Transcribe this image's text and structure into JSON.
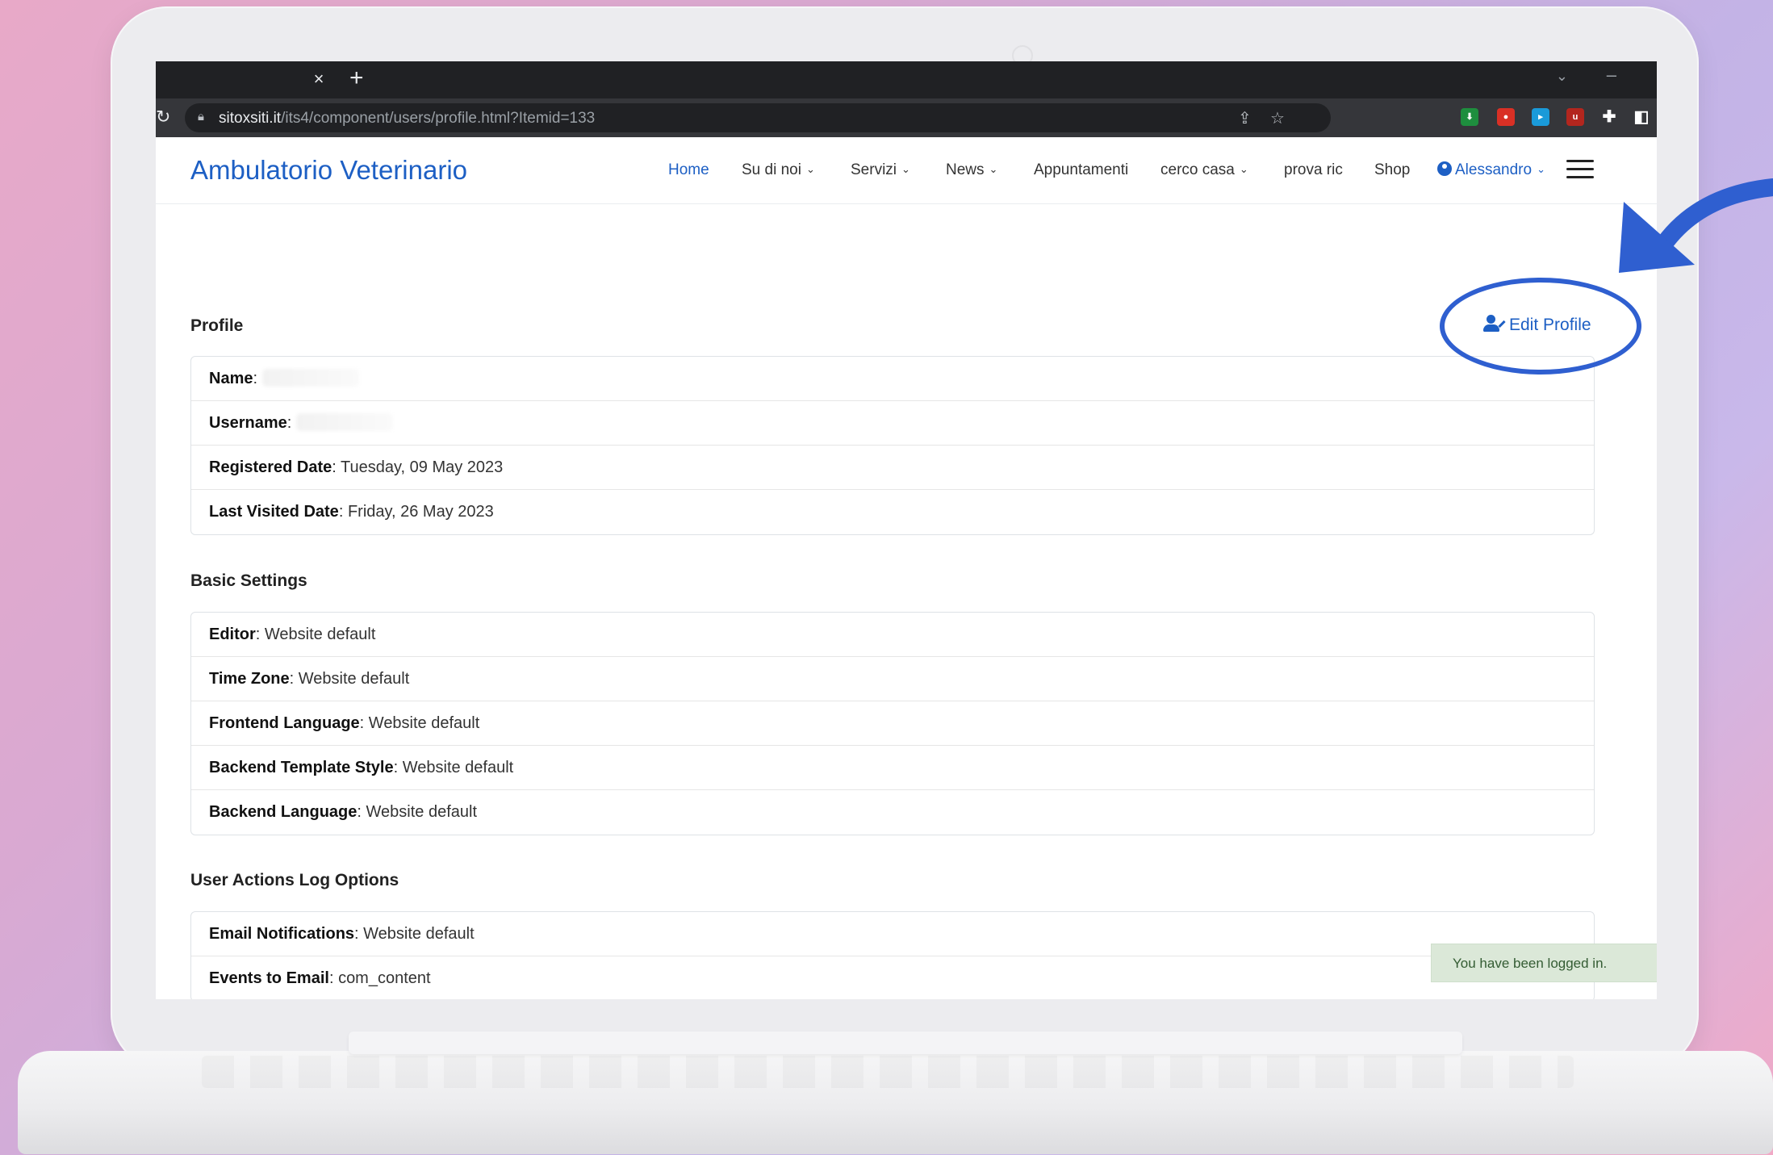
{
  "browser": {
    "tab_close": "×",
    "new_tab": "+",
    "url_host": "sitoxsiti.it",
    "url_path": "/its4/component/users/profile.html?Itemid=133"
  },
  "site": {
    "brand": "Ambulatorio Veterinario",
    "nav": [
      {
        "label": "Home"
      },
      {
        "label": "Su di noi"
      },
      {
        "label": "Servizi"
      },
      {
        "label": "News"
      },
      {
        "label": "Appuntamenti"
      },
      {
        "label": "cerco casa"
      },
      {
        "label": "prova ric"
      },
      {
        "label": "Shop"
      },
      {
        "label": "Alessandro"
      }
    ]
  },
  "profile": {
    "heading": "Profile",
    "edit_label": "Edit Profile",
    "rows": [
      {
        "label": "Name",
        "value": ""
      },
      {
        "label": "Username",
        "value": ""
      },
      {
        "label": "Registered Date",
        "value": "Tuesday, 09 May 2023"
      },
      {
        "label": "Last Visited Date",
        "value": "Friday, 26 May 2023"
      }
    ]
  },
  "basic": {
    "heading": "Basic Settings",
    "rows": [
      {
        "label": "Editor",
        "value": "Website default"
      },
      {
        "label": "Time Zone",
        "value": "Website default"
      },
      {
        "label": "Frontend Language",
        "value": "Website default"
      },
      {
        "label": "Backend Template Style",
        "value": "Website default"
      },
      {
        "label": "Backend Language",
        "value": "Website default"
      }
    ]
  },
  "actions": {
    "heading": "User Actions Log Options",
    "rows": [
      {
        "label": "Email Notifications",
        "value": "Website default"
      },
      {
        "label": "Events to Email",
        "value": "com_content"
      }
    ]
  },
  "toast": "You have been logged in.",
  "colors": {
    "accent": "#1d5fc4",
    "annotation": "#2f5fd0"
  },
  "separator": ": "
}
